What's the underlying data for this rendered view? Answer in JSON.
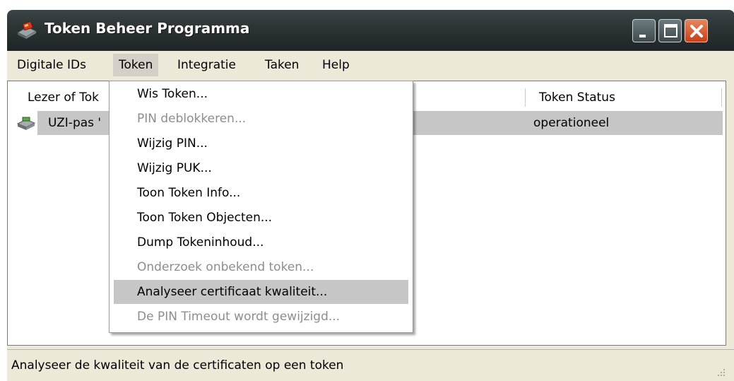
{
  "window": {
    "title": "Token Beheer Programma"
  },
  "title_buttons": {
    "minimize": "minimize",
    "maximize": "maximize",
    "close": "close"
  },
  "menubar": {
    "items": [
      {
        "label": "Digitale IDs"
      },
      {
        "label": "Token"
      },
      {
        "label": "Integratie"
      },
      {
        "label": "Taken"
      },
      {
        "label": "Help"
      }
    ],
    "active": "Token"
  },
  "list": {
    "columns": [
      {
        "label": "Lezer of Tok"
      },
      {
        "label": "Token Status"
      }
    ],
    "rows": [
      {
        "name": "UZI-pas '",
        "status": "operationeel"
      }
    ]
  },
  "token_menu": {
    "items": [
      {
        "label": "Wis Token...",
        "enabled": true
      },
      {
        "label": "PIN deblokkeren...",
        "enabled": false
      },
      {
        "label": "Wijzig PIN...",
        "enabled": true
      },
      {
        "label": "Wijzig PUK...",
        "enabled": true
      },
      {
        "label": "Toon Token Info...",
        "enabled": true
      },
      {
        "label": "Toon Token Objecten...",
        "enabled": true
      },
      {
        "label": "Dump Tokeninhoud...",
        "enabled": true
      },
      {
        "label": "Onderzoek onbekend token...",
        "enabled": false
      },
      {
        "label": "Analyseer certificaat kwaliteit...",
        "enabled": true,
        "highlighted": true
      },
      {
        "label": "De PIN Timeout wordt gewijzigd...",
        "enabled": false
      }
    ]
  },
  "statusbar": {
    "text": "Analyseer de kwaliteit van de certificaten op een token"
  },
  "colors": {
    "titlebar": "#2c3335",
    "close_button": "#d9572b",
    "selection": "#c6c6c6",
    "disabled_text": "#8d8d8d"
  }
}
